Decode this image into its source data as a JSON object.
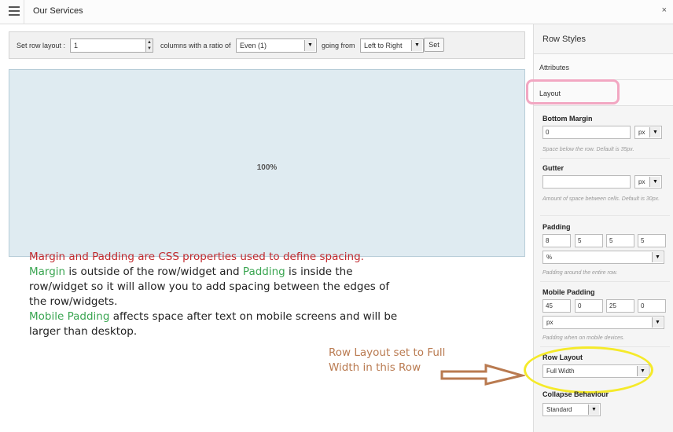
{
  "header": {
    "title": "Our Services",
    "close_glyph": "×"
  },
  "toolbar": {
    "set_row_label": "Set row layout :",
    "columns_value": "1",
    "columns_text": "columns with a ratio of",
    "ratio_selected": "Even (1)",
    "going_from_text": "going from",
    "direction_selected": "Left to Right",
    "set_button": "Set"
  },
  "canvas": {
    "cell_label": "100%"
  },
  "annotation": {
    "line1": "Margin and Padding are CSS properties used to define spacing.",
    "margin_word": "Margin",
    "mid1": " is outside of the row/widget and ",
    "padding_word": "Padding",
    "mid2": " is inside the row/widget so it will allow you to add spacing between the edges of the row/widgets.",
    "mobile_word": "Mobile Padding",
    "mid3": " affects space after text on mobile screens and will be larger than desktop.",
    "note": "Row Layout set to Full Width in this Row"
  },
  "panel": {
    "title": "Row Styles",
    "tab_attributes": "Attributes",
    "tab_layout": "Layout",
    "bottom_margin": {
      "label": "Bottom Margin",
      "value": "0",
      "unit": "px",
      "help": "Space below the row. Default is 35px."
    },
    "gutter": {
      "label": "Gutter",
      "value": "",
      "unit": "px",
      "help": "Amount of space between cells. Default is 30px."
    },
    "padding": {
      "label": "Padding",
      "top": "8",
      "right": "5",
      "bottom": "5",
      "left": "5",
      "unit": "%",
      "help": "Padding around the entire row."
    },
    "mobile_padding": {
      "label": "Mobile Padding",
      "top": "45",
      "right": "0",
      "bottom": "25",
      "left": "0",
      "unit": "px",
      "help": "Padding when on mobile devices."
    },
    "row_layout": {
      "label": "Row Layout",
      "value": "Full Width"
    },
    "collapse": {
      "label": "Collapse Behaviour",
      "value": "Standard"
    }
  },
  "colors": {
    "annotation_red": "#c0282d",
    "annotation_green": "#3aa551",
    "note_brown": "#b97a50",
    "highlight_pink": "#f2a7c2",
    "highlight_yellow": "#f5ea2a",
    "cell_bg": "#dfebf1"
  }
}
